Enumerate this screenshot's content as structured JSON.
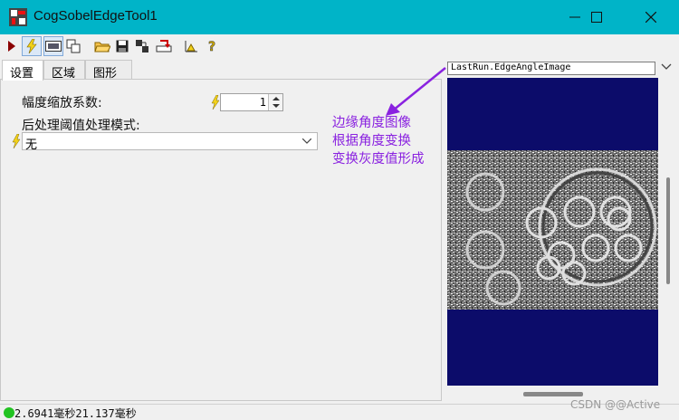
{
  "window": {
    "title": "CogSobelEdgeTool1"
  },
  "toolbar": {
    "buttons": [
      "run-icon",
      "bolt-icon",
      "image-icon",
      "copy-icon",
      "open-folder-icon",
      "save-icon",
      "connect-icon",
      "load-icon",
      "chart-icon",
      "help-icon"
    ]
  },
  "tabs": [
    {
      "label": "设置"
    },
    {
      "label": "区域"
    },
    {
      "label": "图形"
    }
  ],
  "settings": {
    "scale_label": "幅度缩放系数:",
    "scale_value": "1",
    "threshold_label": "后处理阈值处理模式:",
    "threshold_value": "无"
  },
  "annotation": {
    "line1": "边缘角度图像",
    "line2": "根据角度变换",
    "line3": "变换灰度值形成",
    "color": "#8a22e0"
  },
  "viewer": {
    "image_selector": "LastRun.EdgeAngleImage"
  },
  "status": {
    "text": "2.6941毫秒21.137毫秒",
    "indicator_color": "#22c322"
  },
  "watermark": "CSDN @@Active"
}
